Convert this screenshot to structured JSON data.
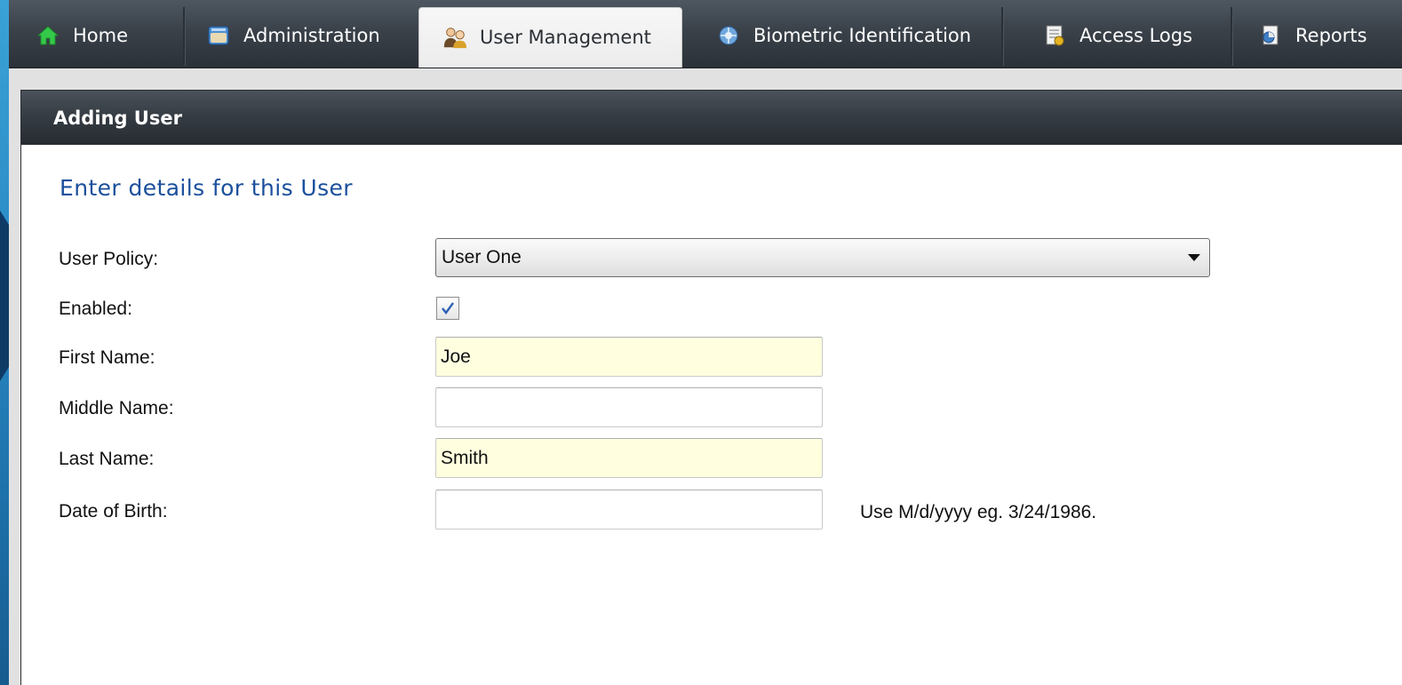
{
  "tabs": [
    {
      "label": "Home",
      "icon": "home-icon"
    },
    {
      "label": "Administration",
      "icon": "administration-icon"
    },
    {
      "label": "User Management",
      "icon": "user-management-icon",
      "active": true
    },
    {
      "label": "Biometric Identification",
      "icon": "biometric-icon"
    },
    {
      "label": "Access Logs",
      "icon": "access-logs-icon"
    },
    {
      "label": "Reports",
      "icon": "reports-icon"
    }
  ],
  "panel": {
    "title": "Adding User",
    "subtitle": "Enter details for this User"
  },
  "form": {
    "user_policy": {
      "label": "User Policy:",
      "value": "User One"
    },
    "enabled": {
      "label": "Enabled:",
      "checked": true
    },
    "first_name": {
      "label": "First Name:",
      "value": "Joe"
    },
    "middle_name": {
      "label": "Middle Name:",
      "value": ""
    },
    "last_name": {
      "label": "Last Name:",
      "value": "Smith"
    },
    "date_of_birth": {
      "label": "Date of Birth:",
      "value": "",
      "hint": "Use M/d/yyyy eg. 3/24/1986."
    }
  },
  "colors": {
    "subtitle": "#1b4f9c",
    "filled_field": "#ffffe0",
    "pointer": "#0e3a66"
  }
}
